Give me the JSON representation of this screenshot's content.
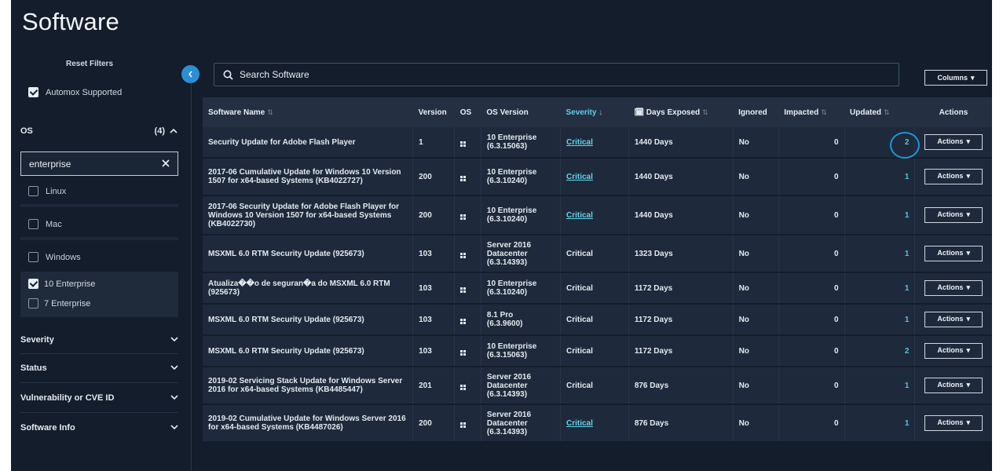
{
  "page": {
    "title": "Software"
  },
  "sidebar": {
    "reset_filters": "Reset Filters",
    "automox_supported": "Automox Supported",
    "os": {
      "label": "OS",
      "count": "(4)",
      "search_value": "enterprise",
      "options": [
        "Linux",
        "Mac",
        "Windows"
      ],
      "windows_sub": [
        {
          "label": "10 Enterprise",
          "checked": true
        },
        {
          "label": "7 Enterprise",
          "checked": false
        }
      ]
    },
    "filters": [
      "Severity",
      "Status",
      "Vulnerability or CVE ID",
      "Software Info"
    ]
  },
  "toolbar": {
    "search_placeholder": "Search Software",
    "columns_label": "Columns"
  },
  "table": {
    "headers": {
      "name": "Software Name",
      "version": "Version",
      "os": "OS",
      "os_version": "OS Version",
      "severity": "Severity",
      "days_exposed": "Days Exposed",
      "ignored": "Ignored",
      "impacted": "Impacted",
      "updated": "Updated",
      "actions": "Actions"
    },
    "actions_label": "Actions",
    "rows": [
      {
        "name": "Security Update for Adobe Flash Player",
        "version": "1",
        "os_version": "10 Enterprise\n(6.3.15063)",
        "severity": "Critical",
        "severity_link": true,
        "days": "1440 Days",
        "ignored": "No",
        "impacted": "0",
        "updated": "2"
      },
      {
        "name": "2017-06 Cumulative Update for Windows 10 Version 1507 for x64-based Systems (KB4022727)",
        "version": "200",
        "os_version": "10 Enterprise\n(6.3.10240)",
        "severity": "Critical",
        "severity_link": true,
        "days": "1440 Days",
        "ignored": "No",
        "impacted": "0",
        "updated": "1"
      },
      {
        "name": "2017-06 Security Update for Adobe Flash Player for Windows 10 Version 1507 for x64-based Systems (KB4022730)",
        "version": "200",
        "os_version": "10 Enterprise\n(6.3.10240)",
        "severity": "Critical",
        "severity_link": true,
        "days": "1440 Days",
        "ignored": "No",
        "impacted": "0",
        "updated": "1"
      },
      {
        "name": "MSXML 6.0 RTM Security Update (925673)",
        "version": "103",
        "os_version": "Server 2016\nDatacenter\n(6.3.14393)",
        "severity": "Critical",
        "severity_link": false,
        "days": "1323 Days",
        "ignored": "No",
        "impacted": "0",
        "updated": "1"
      },
      {
        "name": "Atualiza��o de seguran�a do MSXML 6.0 RTM (925673)",
        "version": "103",
        "os_version": "10 Enterprise\n(6.3.10240)",
        "severity": "Critical",
        "severity_link": false,
        "days": "1172 Days",
        "ignored": "No",
        "impacted": "0",
        "updated": "1"
      },
      {
        "name": "MSXML 6.0 RTM Security Update (925673)",
        "version": "103",
        "os_version": "8.1 Pro\n(6.3.9600)",
        "severity": "Critical",
        "severity_link": false,
        "days": "1172 Days",
        "ignored": "No",
        "impacted": "0",
        "updated": "1"
      },
      {
        "name": "MSXML 6.0 RTM Security Update (925673)",
        "version": "103",
        "os_version": "10 Enterprise\n(6.3.15063)",
        "severity": "Critical",
        "severity_link": false,
        "days": "1172 Days",
        "ignored": "No",
        "impacted": "0",
        "updated": "2"
      },
      {
        "name": "2019-02 Servicing Stack Update for Windows Server 2016 for x64-based Systems (KB4485447)",
        "version": "201",
        "os_version": "Server 2016\nDatacenter\n(6.3.14393)",
        "severity": "Critical",
        "severity_link": false,
        "days": "876 Days",
        "ignored": "No",
        "impacted": "0",
        "updated": "1"
      },
      {
        "name": "2019-02 Cumulative Update for Windows Server 2016 for x64-based Systems (KB4487026)",
        "version": "200",
        "os_version": "Server 2016\nDatacenter\n(6.3.14393)",
        "severity": "Critical",
        "severity_link": true,
        "days": "876 Days",
        "ignored": "No",
        "impacted": "0",
        "updated": "1"
      }
    ]
  },
  "colors": {
    "background": "#131d2b",
    "row": "#1e2a3b",
    "header": "#243042",
    "accent": "#2b8fd6",
    "link": "#65d3ea"
  }
}
